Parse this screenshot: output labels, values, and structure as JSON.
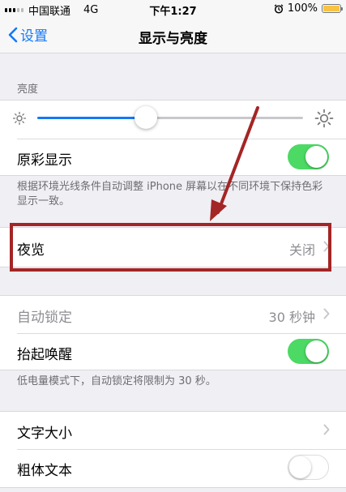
{
  "status_bar": {
    "carrier": "中国联通",
    "network": "4G",
    "time": "下午1:27",
    "battery": "100%"
  },
  "nav": {
    "back_label": "设置",
    "title": "显示与亮度"
  },
  "brightness": {
    "section_label": "亮度",
    "level": 0.41
  },
  "true_tone": {
    "label": "原彩显示",
    "on": true,
    "note": "根据环境光线条件自动调整 iPhone 屏幕以在不同环境下保持色彩显示一致。"
  },
  "night_shift": {
    "label": "夜览",
    "value": "关闭"
  },
  "auto_lock": {
    "label": "自动锁定",
    "value": "30 秒钟"
  },
  "raise_to_wake": {
    "label": "抬起唤醒",
    "on": true,
    "note": "低电量模式下，自动锁定将限制为 30 秒。"
  },
  "text_size": {
    "label": "文字大小"
  },
  "bold_text": {
    "label": "粗体文本",
    "on": false
  },
  "colors": {
    "accent": "#1479f7",
    "switch_on": "#4cd964",
    "annotation": "#a42525"
  }
}
